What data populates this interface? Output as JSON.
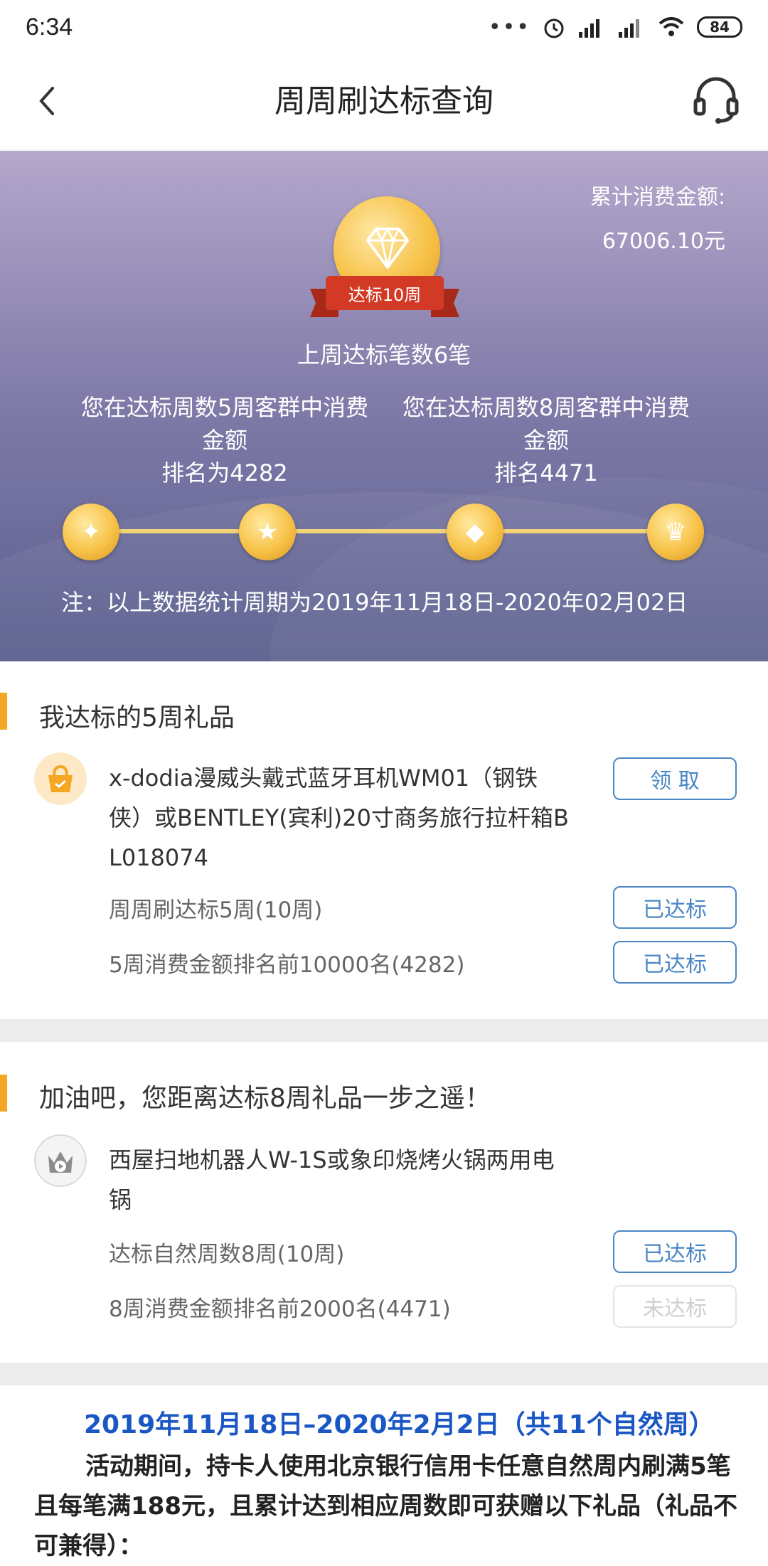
{
  "status_bar": {
    "time": "6:34",
    "battery": "84"
  },
  "nav": {
    "title": "周周刷达标查询"
  },
  "hero": {
    "total_label": "累计消费金额:",
    "total_value": "67006.10元",
    "badge_label": "达标10周",
    "last_week": "上周达标笔数6笔",
    "rank_left_line1": "您在达标周数5周客群中消费",
    "rank_left_line2": "金额",
    "rank_left_line3": "排名为4282",
    "rank_right_line1": "您在达标周数8周客群中消费",
    "rank_right_line2": "金额",
    "rank_right_line3": "排名4471",
    "note": "注：以上数据统计周期为2019年11月18日-2020年02月02日"
  },
  "section1": {
    "title": "我达标的5周礼品",
    "gift_line1": "x-dodia漫威头戴式蓝牙耳机WM01（钢铁",
    "gift_line2": "侠）或BENTLEY(宾利)20寸商务旅行拉杆箱B",
    "gift_line3": "L018074",
    "claim_button": "领 取",
    "cond1": "周周刷达标5周(10周)",
    "cond1_status": "已达标",
    "cond2": "5周消费金额排名前10000名(4282)",
    "cond2_status": "已达标"
  },
  "section2": {
    "title": "加油吧，您距离达标8周礼品一步之遥！",
    "gift_line1": "西屋扫地机器人W-1S或象印烧烤火锅两用电",
    "gift_line2": "锅",
    "cond1": "达标自然周数8周(10周)",
    "cond1_status": "已达标",
    "cond2": "8周消费金额排名前2000名(4471)",
    "cond2_status": "未达标"
  },
  "rules": {
    "period": "2019年11月18日–2020年2月2日（共11个自然周）",
    "body": "活动期间，持卡人使用北京银行信用卡任意自然周内刷满5笔且每笔满188元，且累计达到相应周数即可获赠以下礼品（礼品不可兼得）："
  },
  "colors": {
    "accent": "#f5a623",
    "button_blue": "#4a86c5",
    "link_blue": "#1a56c4"
  }
}
